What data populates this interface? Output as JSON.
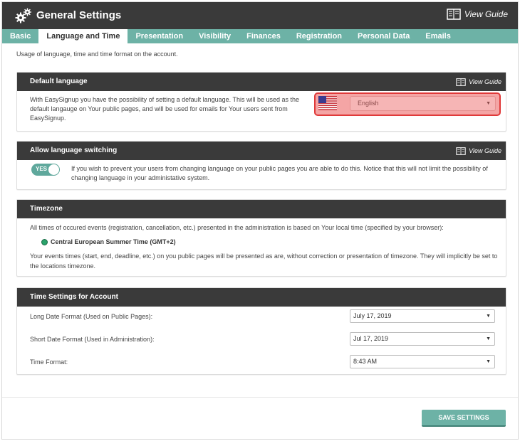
{
  "header": {
    "title": "General Settings",
    "view_guide": "View Guide"
  },
  "tabs": [
    {
      "label": "Basic"
    },
    {
      "label": "Language and Time"
    },
    {
      "label": "Presentation"
    },
    {
      "label": "Visibility"
    },
    {
      "label": "Finances"
    },
    {
      "label": "Registration"
    },
    {
      "label": "Personal Data"
    },
    {
      "label": "Emails"
    }
  ],
  "active_tab": "Language and Time",
  "description": "Usage of language, time and time format on the account.",
  "default_language": {
    "title": "Default language",
    "view_guide": "View Guide",
    "text": "With EasySignup you have the possibility of setting a default language. This will be used as the default langauge on Your public pages, and will be used for emails for Your users sent from EasySignup.",
    "selected": "English",
    "flag": "us-flag-icon"
  },
  "language_switching": {
    "title": "Allow language switching",
    "view_guide": "View Guide",
    "toggle_label": "YES",
    "text": "If you wish to prevent your users from changing language on your public pages you are able to do this. Notice that this will not limit the possibility of changing language in your administative system."
  },
  "timezone": {
    "title": "Timezone",
    "text1": "All times of occured events (registration, cancellation, etc.) presented in the administration is based on Your local time (specified by your browser):",
    "zone": "Central European Summer Time (GMT+2)",
    "text2": "Your events times (start, end, deadline, etc.) on you public pages will be presented as are, without correction or presentation of timezone. They will implicitly be set to the locations timezone."
  },
  "time_settings": {
    "title": "Time Settings for Account",
    "long_label": "Long Date Format (Used on Public Pages):",
    "long_value": "July 17, 2019",
    "short_label": "Short Date Format (Used in Administration):",
    "short_value": "Jul 17, 2019",
    "time_label": "Time Format:",
    "time_value": "8:43 AM"
  },
  "save_label": "SAVE SETTINGS",
  "colors": {
    "dark": "#3a3a3a",
    "accent": "#6db2a6",
    "highlight": "#e03a3a"
  }
}
